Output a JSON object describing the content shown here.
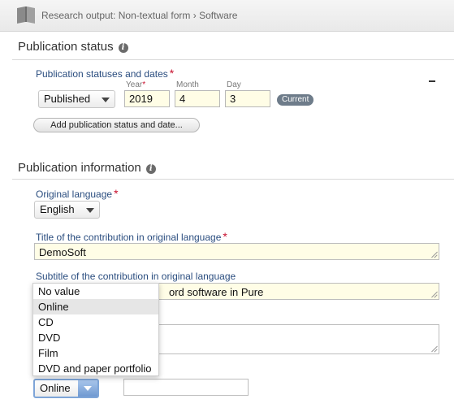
{
  "header": {
    "breadcrumb": "Research output: Non-textual form › Software"
  },
  "publication_status": {
    "title": "Publication status",
    "statuses_label": "Publication statuses and dates",
    "required_mark": "*",
    "status_value": "Published",
    "year_label": "Year",
    "month_label": "Month",
    "day_label": "Day",
    "year": "2019",
    "month": "4",
    "day": "3",
    "current_badge": "Current",
    "add_button": "Add publication status and date..."
  },
  "publication_info": {
    "title": "Publication information",
    "original_language_label": "Original language",
    "original_language": "English",
    "title_label": "Title of the contribution in original language",
    "title_value": "DemoSoft",
    "subtitle_label": "Subtitle of the contribution in original language",
    "subtitle_value_visible": "ord software in Pure",
    "media_select_value": "Online"
  },
  "dropdown": {
    "options": [
      "No value",
      "Online",
      "CD",
      "DVD",
      "Film",
      "DVD and paper portfolio"
    ],
    "highlighted": "Online"
  }
}
